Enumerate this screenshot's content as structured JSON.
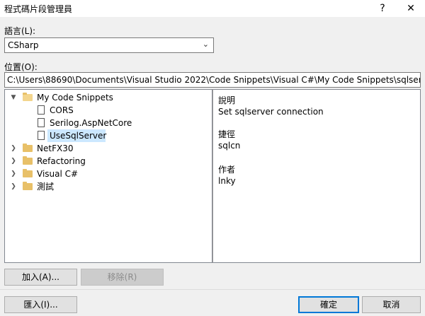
{
  "window": {
    "title": "程式碼片段管理員",
    "help_glyph": "?",
    "close_glyph": "✕"
  },
  "language": {
    "label": "語言(L):",
    "value": "CSharp"
  },
  "location": {
    "label": "位置(O):",
    "value": "C:\\Users\\88690\\Documents\\Visual Studio 2022\\Code Snippets\\Visual C#\\My Code Snippets\\sqlserver.s"
  },
  "tree": {
    "items": [
      {
        "label": "My Code Snippets",
        "kind": "folder",
        "expanded": true
      },
      {
        "label": "CORS",
        "kind": "snippet"
      },
      {
        "label": "Serilog.AspNetCore",
        "kind": "snippet"
      },
      {
        "label": "UseSqlServer",
        "kind": "snippet",
        "selected": true
      },
      {
        "label": "NetFX30",
        "kind": "folder",
        "expanded": false
      },
      {
        "label": "Refactoring",
        "kind": "folder",
        "expanded": false
      },
      {
        "label": "Visual C#",
        "kind": "folder",
        "expanded": false
      },
      {
        "label": "測試",
        "kind": "folder",
        "expanded": false
      }
    ]
  },
  "details": {
    "description_label": "說明",
    "description_value": "Set sqlserver connection",
    "shortcut_label": "捷徑",
    "shortcut_value": "sqlcn",
    "author_label": "作者",
    "author_value": "lnky"
  },
  "buttons": {
    "add": "加入(A)...",
    "remove": "移除(R)",
    "import": "匯入(I)...",
    "ok": "確定",
    "cancel": "取消"
  },
  "colors": {
    "accent": "#0078d7",
    "selection": "#cce8ff",
    "folder": "#e8c068"
  }
}
